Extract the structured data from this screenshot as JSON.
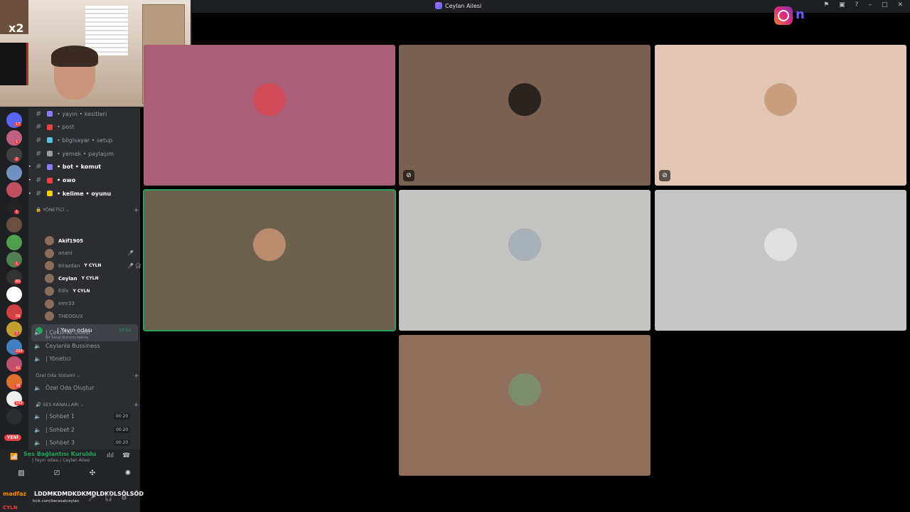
{
  "window": {
    "title": "Ceylan Ailesi",
    "controls": [
      "inbox-icon",
      "screen-icon",
      "help-icon",
      "minimize-icon",
      "maximize-icon",
      "close-icon"
    ]
  },
  "webcam": {
    "overlay_text": "x2"
  },
  "server_rail": {
    "badges": [
      "17",
      "1",
      "2",
      "",
      "",
      "1",
      "",
      "",
      "1",
      "65",
      "",
      "58",
      "2",
      "284",
      "42",
      "38",
      "169",
      ""
    ],
    "new_label": "YENİ"
  },
  "channels": [
    {
      "label": "• yayın • kesitleri",
      "bold": false,
      "color": "#8a7cff"
    },
    {
      "label": "• post",
      "bold": false,
      "color": "#f23f43"
    },
    {
      "label": "• bilgisayar • setup",
      "bold": false,
      "color": "#5bc0de"
    },
    {
      "label": "• yemek • paylaşım",
      "bold": false,
      "color": "#949ba4"
    },
    {
      "label": "• bot • komut",
      "bold": true,
      "color": "#8a7cff"
    },
    {
      "label": "• owo",
      "bold": true,
      "color": "#f23f43"
    },
    {
      "label": "• kelime • oyunu",
      "bold": true,
      "color": "#f0d000"
    }
  ],
  "categories": {
    "admin": "YÖNETİCİ",
    "private": "Özel Oda Sistemi",
    "voice": "SES KANALLARI"
  },
  "active_channel": {
    "label": "| Yayın odası",
    "sub": "Bir kanal durumu belirle",
    "time": "10:51"
  },
  "members": [
    {
      "name": "Akif1905",
      "tag": "",
      "online": true,
      "status": ""
    },
    {
      "name": "anani",
      "tag": "",
      "online": false,
      "status": "🎤̸"
    },
    {
      "name": "birazdan",
      "tag": "Y CYLN",
      "online": false,
      "status": "🎤̸ 🎧̸"
    },
    {
      "name": "Ceylan",
      "tag": "Y CYLN",
      "online": true,
      "status": ""
    },
    {
      "name": "Edis",
      "tag": "Y CYLN",
      "online": false,
      "status": ""
    },
    {
      "name": "emr33",
      "tag": "",
      "online": false,
      "status": ""
    },
    {
      "name": "THEOGUX",
      "tag": "",
      "online": false,
      "status": ""
    }
  ],
  "voice_channels": [
    {
      "label": "| Çekilme Odası",
      "count": ""
    },
    {
      "label": "Ceylanla Bussiness",
      "count": ""
    },
    {
      "label": "| Yönetici",
      "count": ""
    },
    {
      "label": "Özel Oda Oluştur",
      "count": ""
    },
    {
      "label": "| Sohbet 1",
      "count": "00  20"
    },
    {
      "label": "| Sohbet 2",
      "count": "00  20"
    },
    {
      "label": "| Sohbet 3",
      "count": "00  20"
    }
  ],
  "voice_panel": {
    "status": "Ses Bağlantısı Kuruldu",
    "location": "| Yayın odası / Ceylan Ailesi"
  },
  "user_panel": {
    "name": "madfaz",
    "title": "LDDMKDMDKDKMDLDKDLSÖLSÖD",
    "link": "kick.com/berasatceylan",
    "tag": "CYLN"
  },
  "overlay": {
    "social": "instagram-icon",
    "letter": "n"
  },
  "tiles": [
    {
      "bg": "#a85f77",
      "speaking": false,
      "muted": false,
      "avatar": "#d04a5a"
    },
    {
      "bg": "#7a6050",
      "speaking": false,
      "muted": true,
      "avatar": "#2a2420"
    },
    {
      "bg": "#e2c8b4",
      "speaking": false,
      "muted": true,
      "avatar": "#c8a080"
    },
    {
      "bg": "#6d5f4d",
      "speaking": true,
      "muted": false,
      "avatar": "#b98c6e"
    },
    {
      "bg": "#c4c4c2",
      "speaking": false,
      "muted": false,
      "avatar": "#a8b0b8"
    },
    {
      "bg": "#c6c6c6",
      "speaking": false,
      "muted": false,
      "avatar": "#e0e0e0"
    },
    {
      "bg": "#90705c",
      "speaking": false,
      "muted": false,
      "avatar": "#7c8c6c"
    }
  ]
}
